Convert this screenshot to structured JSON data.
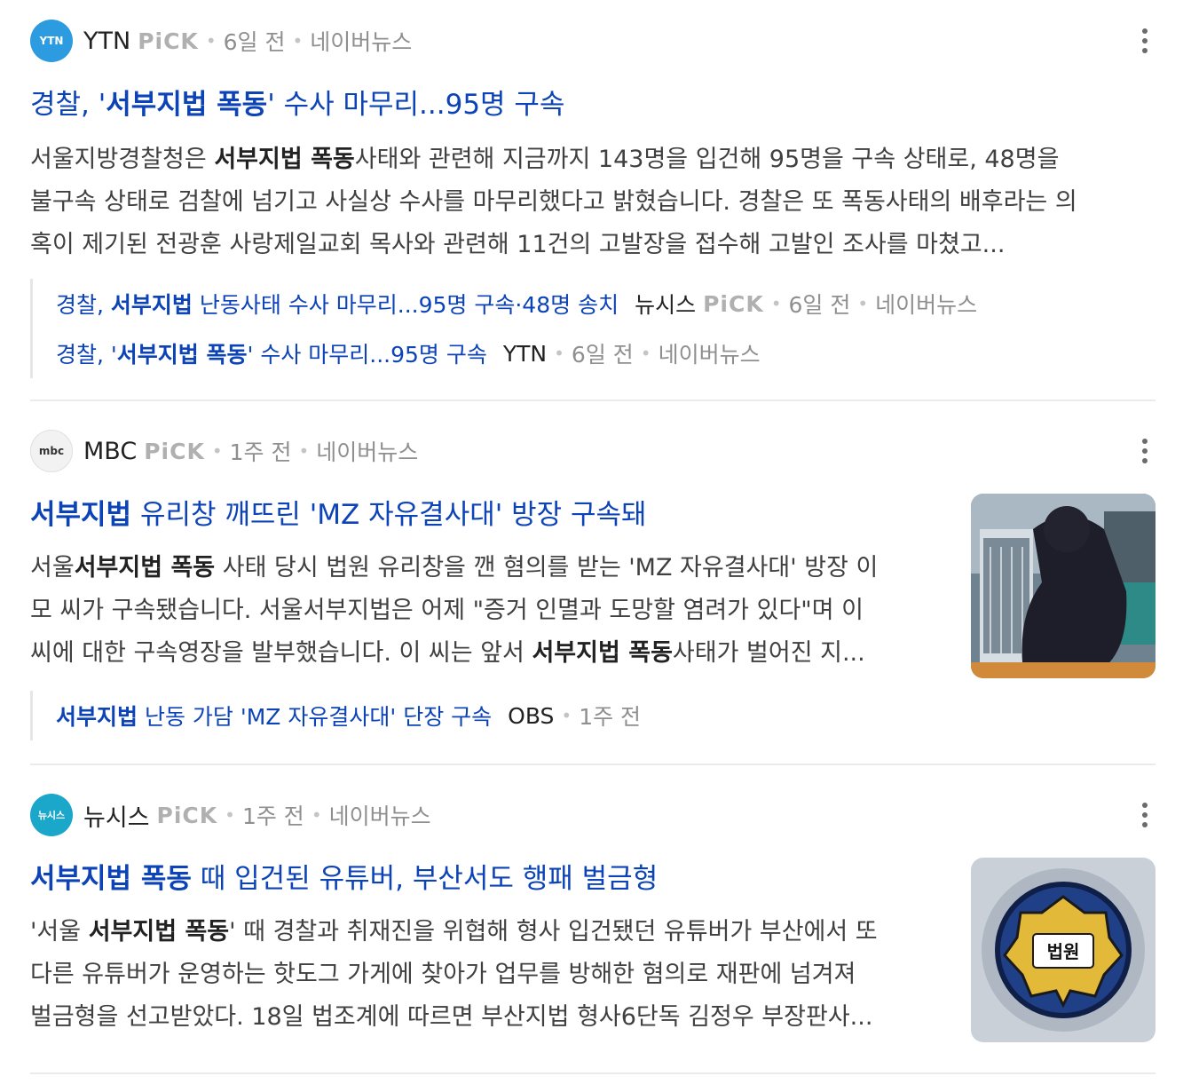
{
  "articles": [
    {
      "press": "YTN",
      "pick": "PiCK",
      "time": "6일 전",
      "platform": "네이버뉴스",
      "logo_text": "YTN",
      "title": {
        "pre": "경찰, '",
        "bold": "서부지법 폭동",
        "post": "' 수사 마무리...95명 구속"
      },
      "desc": {
        "l1_pre": "서울지방경찰청은 ",
        "l1_bold": "서부지법 폭동",
        "l1_post": "사태와 관련해 지금까지 143명을 입건해 95명을 구속 상태로, 48명을",
        "l2": "불구속 상태로 검찰에 넘기고 사실상 수사를 마무리했다고 밝혔습니다. 경찰은 또 폭동사태의 배후라는 의",
        "l3": "혹이 제기된 전광훈 사랑제일교회 목사와 관련해 11건의 고발장을 접수해 고발인 조사를 마쳤고..."
      },
      "related": [
        {
          "t_pre": "경찰, ",
          "t_bold": "서부지법",
          "t_post": " 난동사태 수사 마무리...95명 구속·48명 송치",
          "press": "뉴시스",
          "pick": "PiCK",
          "time": "6일 전",
          "platform": "네이버뉴스"
        },
        {
          "t_pre": "경찰, '",
          "t_bold": "서부지법 폭동",
          "t_post": "' 수사 마무리...95명 구속",
          "press": "YTN",
          "time": "6일 전",
          "platform": "네이버뉴스"
        }
      ]
    },
    {
      "press": "MBC",
      "pick": "PiCK",
      "time": "1주 전",
      "platform": "네이버뉴스",
      "logo_text": "mbc",
      "title": {
        "bold": "서부지법",
        "post": " 유리창 깨뜨린 'MZ 자유결사대' 방장 구속돼"
      },
      "desc": {
        "l1_pre": "서울",
        "l1_bold": "서부지법 폭동",
        "l1_post": " 사태 당시 법원 유리창을 깬 혐의를 받는 'MZ 자유결사대' 방장 이",
        "l2": "모 씨가 구속됐습니다. 서울서부지법은 어제 \"증거 인멸과 도망할 염려가 있다\"며 이",
        "l3_pre": "씨에 대한 구속영장을 발부했습니다. 이 씨는 앞서 ",
        "l3_bold": "서부지법 폭동",
        "l3_post": "사태가 벌어진 지..."
      },
      "related": [
        {
          "t_bold": "서부지법",
          "t_post": " 난동 가담 'MZ 자유결사대' 단장 구속",
          "press": "OBS",
          "time": "1주 전"
        }
      ]
    },
    {
      "press": "뉴시스",
      "pick": "PiCK",
      "time": "1주 전",
      "platform": "네이버뉴스",
      "logo_text": "뉴시스",
      "title": {
        "bold": "서부지법 폭동",
        "post": " 때 입건된 유튜버, 부산서도 행패 벌금형"
      },
      "desc": {
        "l1_pre": "'서울 ",
        "l1_bold": "서부지법 폭동",
        "l1_post": "' 때 경찰과 취재진을 위협해 형사 입건됐던 유튜버가 부산에서 또",
        "l2": "다른 유튜버가 운영하는 핫도그 가게에 찾아가 업무를 방해한 혐의로 재판에 넘겨져",
        "l3": "벌금형을 선고받았다. 18일 법조계에 따르면 부산지법 형사6단독 김정우 부장판사..."
      },
      "thumb_label": "법원"
    }
  ],
  "colors": {
    "link": "#0c43b7",
    "meta": "#8f8f8f",
    "pick": "#b0b0b0"
  }
}
